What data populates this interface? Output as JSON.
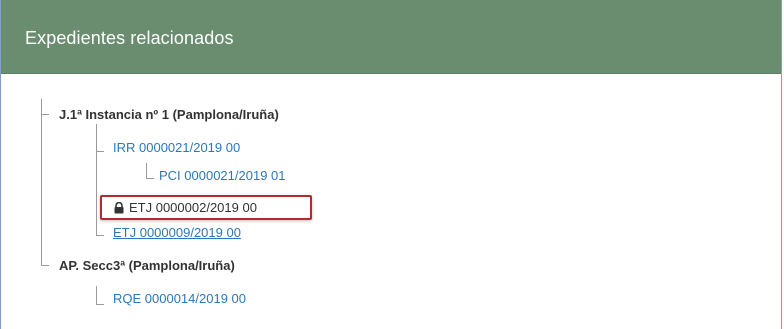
{
  "panel": {
    "title": "Expedientes relacionados"
  },
  "tree": {
    "groups": [
      {
        "court": "J.1ª Instancia nº 1 (Pamplona/Iruña)",
        "items": [
          {
            "label": "IRR 0000021/2019 00",
            "type": "link"
          },
          {
            "label": "PCI 0000021/2019 01",
            "type": "link",
            "child_of": "IRR 0000021/2019 00"
          },
          {
            "label": "ETJ 0000002/2019 00",
            "type": "locked",
            "icon": "lock-icon",
            "highlighted": true
          },
          {
            "label": "ETJ 0000009/2019 00",
            "type": "link",
            "underlined": true
          }
        ]
      },
      {
        "court": "AP. Secc3ª (Pamplona/Iruña)",
        "items": [
          {
            "label": "RQE 0000014/2019 00",
            "type": "link"
          }
        ]
      }
    ]
  },
  "colors": {
    "header_bg": "#6a8d70",
    "link": "#2a77c0",
    "highlight_border": "#b42a2f"
  }
}
